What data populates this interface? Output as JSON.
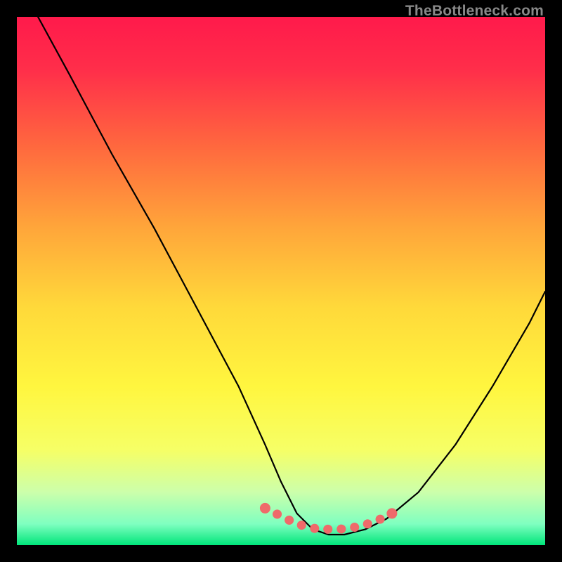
{
  "watermark": "TheBottleneck.com",
  "chart_data": {
    "type": "line",
    "title": "",
    "xlabel": "",
    "ylabel": "",
    "xlim": [
      0,
      100
    ],
    "ylim": [
      0,
      100
    ],
    "grid": false,
    "legend": false,
    "background_gradient": {
      "stops": [
        {
          "pos": 0.0,
          "color": "#ff1a4b"
        },
        {
          "pos": 0.1,
          "color": "#ff2e4a"
        },
        {
          "pos": 0.25,
          "color": "#ff6a3e"
        },
        {
          "pos": 0.4,
          "color": "#ffa63a"
        },
        {
          "pos": 0.55,
          "color": "#ffd93a"
        },
        {
          "pos": 0.7,
          "color": "#fff63f"
        },
        {
          "pos": 0.82,
          "color": "#f6ff66"
        },
        {
          "pos": 0.9,
          "color": "#ccffab"
        },
        {
          "pos": 0.96,
          "color": "#7fffc0"
        },
        {
          "pos": 1.0,
          "color": "#00e57a"
        }
      ]
    },
    "series": [
      {
        "name": "bottleneck-curve",
        "stroke": "#000000",
        "x": [
          4,
          10,
          18,
          26,
          34,
          42,
          47,
          50,
          53,
          56,
          59,
          62,
          66,
          70,
          76,
          83,
          90,
          97,
          100
        ],
        "y": [
          100,
          89,
          74,
          60,
          45,
          30,
          19,
          12,
          6,
          3,
          2,
          2,
          3,
          5,
          10,
          19,
          30,
          42,
          48
        ]
      }
    ],
    "highlight_band": {
      "name": "optimal-range-dots",
      "stroke": "#ef6a6a",
      "x": [
        47,
        49,
        51,
        53,
        55,
        57,
        59,
        61,
        63,
        65,
        67,
        69,
        71
      ],
      "y": [
        7,
        6,
        5,
        4,
        3.5,
        3,
        3,
        3,
        3.2,
        3.6,
        4.2,
        5,
        6
      ]
    }
  }
}
